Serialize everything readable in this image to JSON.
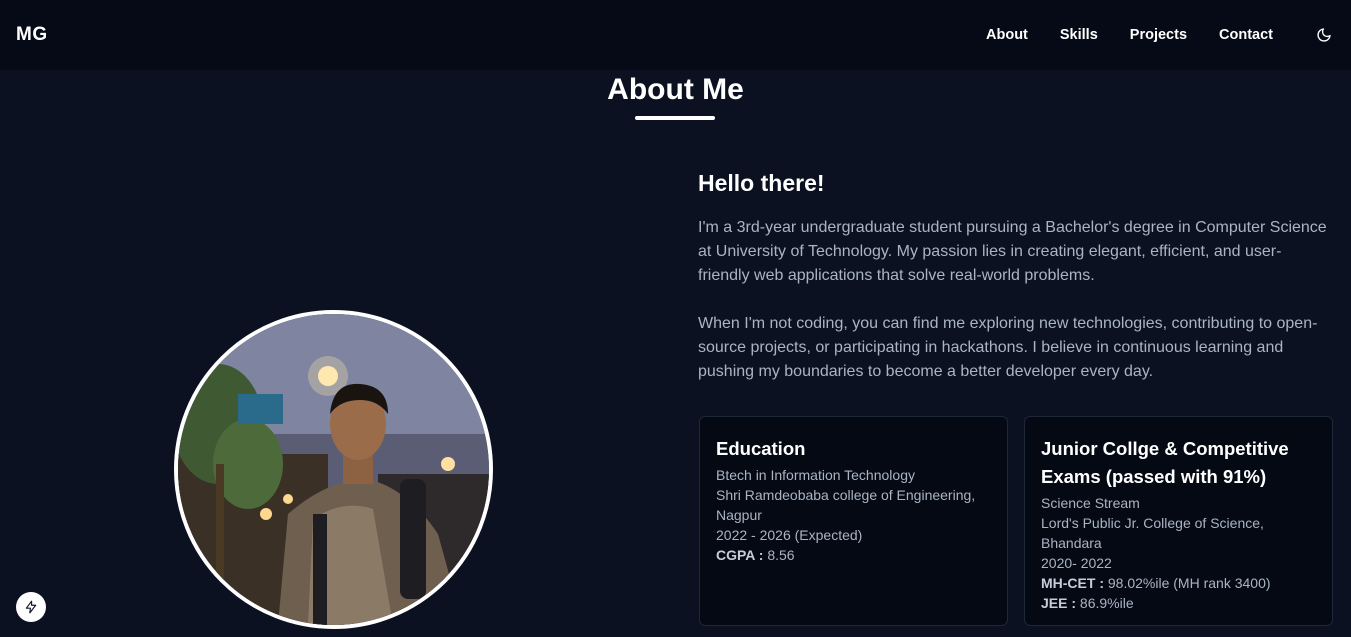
{
  "nav": {
    "logo": "MG",
    "links": [
      "About",
      "Skills",
      "Projects",
      "Contact"
    ],
    "theme_icon": "moon-icon"
  },
  "about": {
    "title": "About Me",
    "greeting": "Hello there!",
    "para1": "I'm a 3rd-year undergraduate student pursuing a Bachelor's degree in Computer Science at University of Technology. My passion lies in creating elegant, efficient, and user-friendly web applications that solve real-world problems.",
    "para2": "When I'm not coding, you can find me exploring new technologies, contributing to open-source projects, or participating in hackathons. I believe in continuous learning and pushing my boundaries to become a better developer every day."
  },
  "education": {
    "title": "Education",
    "degree": "Btech in Information Technology",
    "college": "Shri Ramdeobaba college of Engineering, Nagpur",
    "years": "2022 - 2026 (Expected)",
    "cgpa_label": "CGPA :",
    "cgpa_value": " 8.56"
  },
  "junior": {
    "title": "Junior Collge & Competitive Exams (passed with 91%)",
    "stream": "Science Stream",
    "college": "Lord's Public Jr. College of Science, Bhandara",
    "years": "2020- 2022",
    "mhcet_label": "MH-CET :",
    "mhcet_value": " 98.02%ile (MH rank 3400)",
    "jee_label": "JEE :",
    "jee_value": " 86.9%ile"
  },
  "fab_icon": "lightning-icon",
  "colors": {
    "background": "#0b1120",
    "navbar": "#050a16",
    "card": "#040914",
    "muted_text": "#aab4c3"
  }
}
